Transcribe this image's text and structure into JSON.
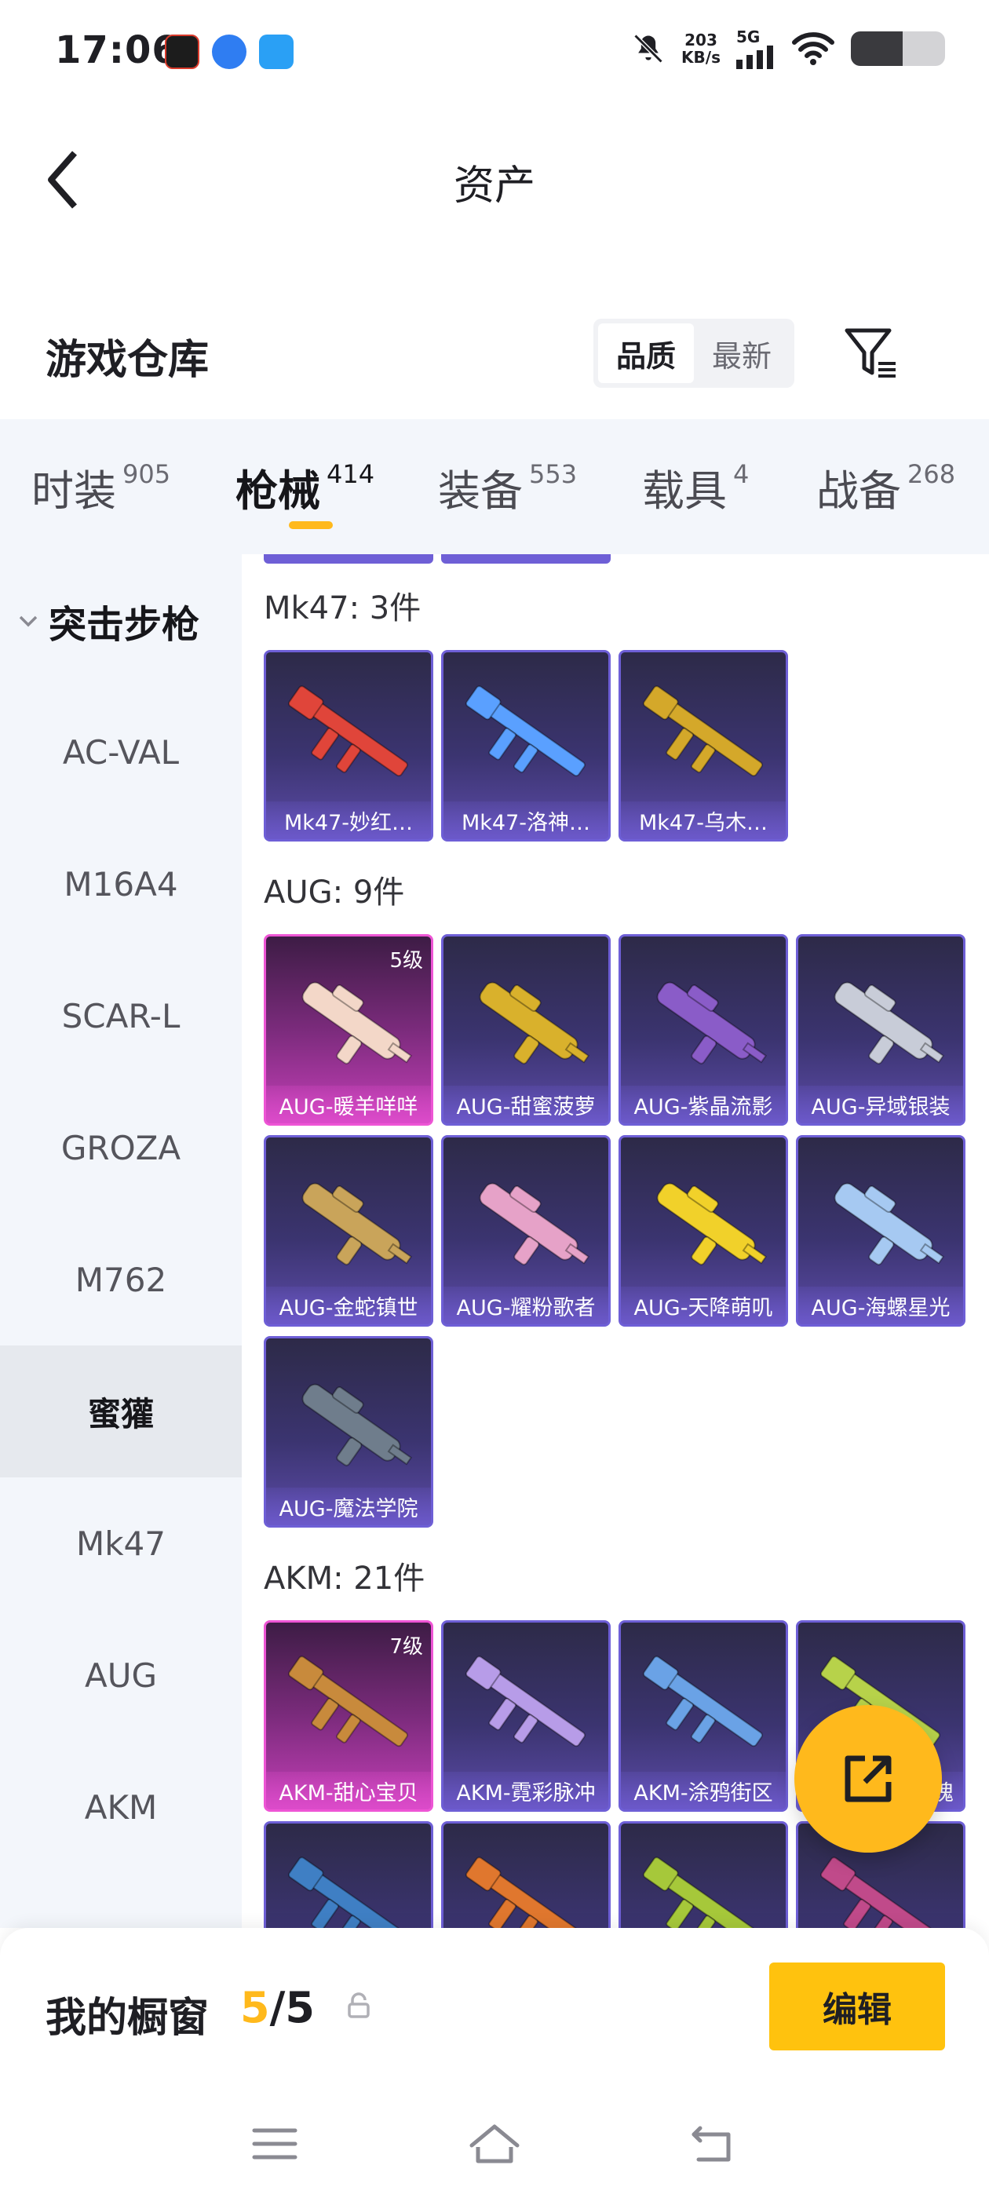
{
  "status_bar": {
    "time": "17:06",
    "net_speed_value": "203",
    "net_speed_unit": "KB/s",
    "network_gen": "5G",
    "battery_level": 0.55
  },
  "header": {
    "title": "资产"
  },
  "warehouse": {
    "title": "游戏仓库",
    "sort_options": [
      "品质",
      "最新"
    ],
    "active_sort": "品质"
  },
  "tabs": [
    {
      "label": "时装",
      "count": "905"
    },
    {
      "label": "枪械",
      "count": "414"
    },
    {
      "label": "装备",
      "count": "553"
    },
    {
      "label": "载具",
      "count": "4"
    },
    {
      "label": "战备",
      "count": "268"
    }
  ],
  "active_tab": "枪械",
  "sidebar": {
    "group": "突击步枪",
    "items": [
      "AC-VAL",
      "M16A4",
      "SCAR-L",
      "GROZA",
      "M762",
      "蜜獾",
      "Mk47",
      "AUG",
      "AKM"
    ],
    "active_item": "蜜獾"
  },
  "sections": [
    {
      "title": "Mk47: 3件",
      "items": [
        {
          "name": "Mk47-妙红…",
          "level": "",
          "rarity": "purple",
          "gun_color": "#e0453a"
        },
        {
          "name": "Mk47-洛神…",
          "level": "",
          "rarity": "purple",
          "gun_color": "#5aa0ff"
        },
        {
          "name": "Mk47-乌木…",
          "level": "",
          "rarity": "purple",
          "gun_color": "#d4a82a"
        }
      ]
    },
    {
      "title": "AUG: 9件",
      "items": [
        {
          "name": "AUG-暖羊咩咩",
          "level": "5级",
          "rarity": "pink",
          "gun_color": "#f3d7c8"
        },
        {
          "name": "AUG-甜蜜菠萝",
          "level": "",
          "rarity": "purple",
          "gun_color": "#d9b12c"
        },
        {
          "name": "AUG-紫晶流影",
          "level": "",
          "rarity": "purple",
          "gun_color": "#8a5cc8"
        },
        {
          "name": "AUG-异域银装",
          "level": "",
          "rarity": "purple",
          "gun_color": "#c8ccd8"
        },
        {
          "name": "AUG-金蛇镇世",
          "level": "",
          "rarity": "purple",
          "gun_color": "#c9a45a"
        },
        {
          "name": "AUG-耀粉歌者",
          "level": "",
          "rarity": "purple",
          "gun_color": "#e6a2c8"
        },
        {
          "name": "AUG-天降萌叽",
          "level": "",
          "rarity": "purple",
          "gun_color": "#f1d12a"
        },
        {
          "name": "AUG-海螺星光",
          "level": "",
          "rarity": "purple",
          "gun_color": "#a6c9f2"
        },
        {
          "name": "AUG-魔法学院",
          "level": "",
          "rarity": "purple",
          "gun_color": "#6f7d8c"
        }
      ]
    },
    {
      "title": "AKM: 21件",
      "items": [
        {
          "name": "AKM-甜心宝贝",
          "level": "7级",
          "rarity": "pink",
          "gun_color": "#c88a3c"
        },
        {
          "name": "AKM-霓彩脉冲",
          "level": "",
          "rarity": "purple",
          "gun_color": "#b79ce8"
        },
        {
          "name": "AKM-涂鸦街区",
          "level": "",
          "rarity": "purple",
          "gun_color": "#6aa2e6"
        },
        {
          "name": "",
          "level": "",
          "rarity": "purple",
          "gun_color": "#b7d24a",
          "partial_label": "魄"
        },
        {
          "name": "",
          "level": "",
          "rarity": "purple",
          "gun_color": "#3f7fc4"
        },
        {
          "name": "",
          "level": "",
          "rarity": "purple",
          "gun_color": "#e0772e"
        },
        {
          "name": "",
          "level": "",
          "rarity": "purple",
          "gun_color": "#a6c83a"
        },
        {
          "name": "",
          "level": "",
          "rarity": "purple",
          "gun_color": "#c04a8a"
        }
      ]
    }
  ],
  "bottom": {
    "window_label": "我的橱窗",
    "count_current": "5",
    "count_separator": "/",
    "count_total": "5",
    "edit_label": "编辑"
  },
  "colors": {
    "accent": "#ffb91c",
    "purple_border": "#6e5fd6",
    "pink_border": "#ee55d5"
  }
}
